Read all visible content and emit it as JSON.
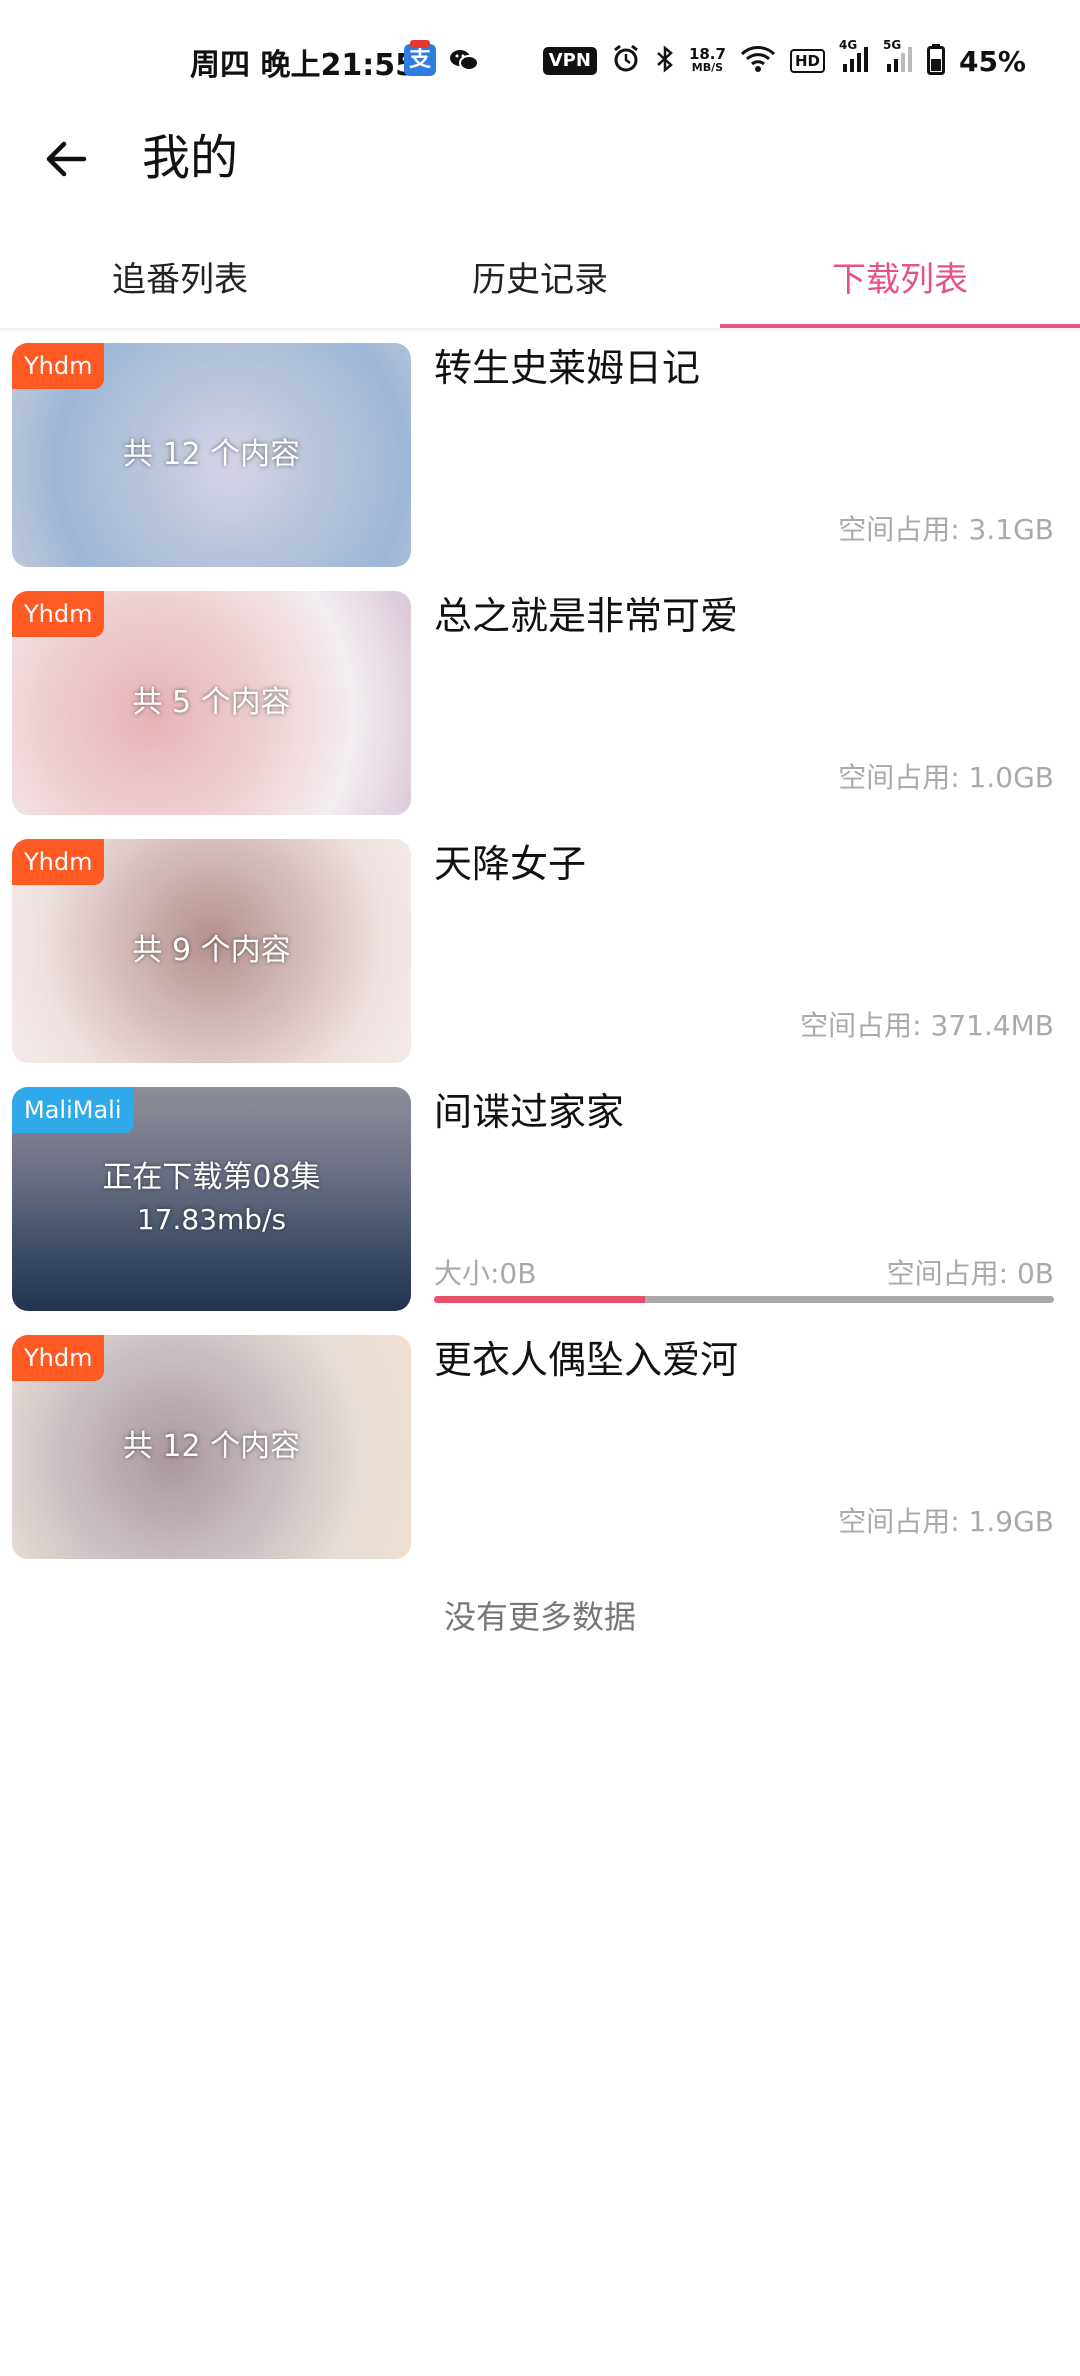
{
  "status_bar": {
    "time": "周四 晚上21:55",
    "vpn": "VPN",
    "speed_value": "18.7",
    "speed_unit": "MB/S",
    "hd": "HD",
    "net1": "4G",
    "net2": "5G",
    "battery": "45%"
  },
  "header": {
    "title": "我的"
  },
  "tabs": [
    {
      "label": "追番列表",
      "active": false
    },
    {
      "label": "历史记录",
      "active": false
    },
    {
      "label": "下载列表",
      "active": true
    }
  ],
  "items": [
    {
      "source": "Yhdm",
      "source_color": "#ff5a23",
      "count_text": "共 12 个内容",
      "title": "转生史莱姆日记",
      "space": "空间占用: 3.1GB",
      "thumb_gradient": "radial-gradient(circle at 55% 55%, #d6d4e6 0%, #b9c4dc 35%, #9cb8d6 70%, #c7c9dd 100%)"
    },
    {
      "source": "Yhdm",
      "source_color": "#ff5a23",
      "count_text": "共 5 个内容",
      "title": "总之就是非常可爱",
      "space": "空间占用: 1.0GB",
      "thumb_gradient": "radial-gradient(circle at 35% 55%, #e6b2b8 0%, #efd0d2 40%, #f3eef1 70%, #d9c6d6 100%)"
    },
    {
      "source": "Yhdm",
      "source_color": "#ff5a23",
      "count_text": "共 9 个内容",
      "title": "天降女子",
      "space": "空间占用: 371.4MB",
      "thumb_gradient": "radial-gradient(circle at 50% 45%, #b5908e 0%, #d4bcbb 40%, #efe3e1 75%, #f4ecea 100%)"
    },
    {
      "source": "MaliMali",
      "source_color": "#2fa9ea",
      "count_text": "正在下载第08集",
      "speed_text": "17.83mb/s",
      "title": "间谍过家家",
      "size": "大小:0B",
      "space": "空间占用: 0B",
      "progress": 0.34,
      "thumb_gradient": "linear-gradient(180deg, #8d8f9a 0%, #6a6e82 40%, #3b4a66 75%, #22344f 100%)"
    },
    {
      "source": "Yhdm",
      "source_color": "#ff5a23",
      "count_text": "共 12 个内容",
      "title": "更衣人偶坠入爱河",
      "space": "空间占用: 1.9GB",
      "thumb_gradient": "radial-gradient(circle at 40% 55%, #a9989f 0%, #c9bfc2 40%, #e6ddd6 70%, #efe0d2 100%)"
    }
  ],
  "footer": {
    "no_more": "没有更多数据"
  },
  "colors": {
    "accent": "#e8508a",
    "progress": "#e8506a"
  }
}
